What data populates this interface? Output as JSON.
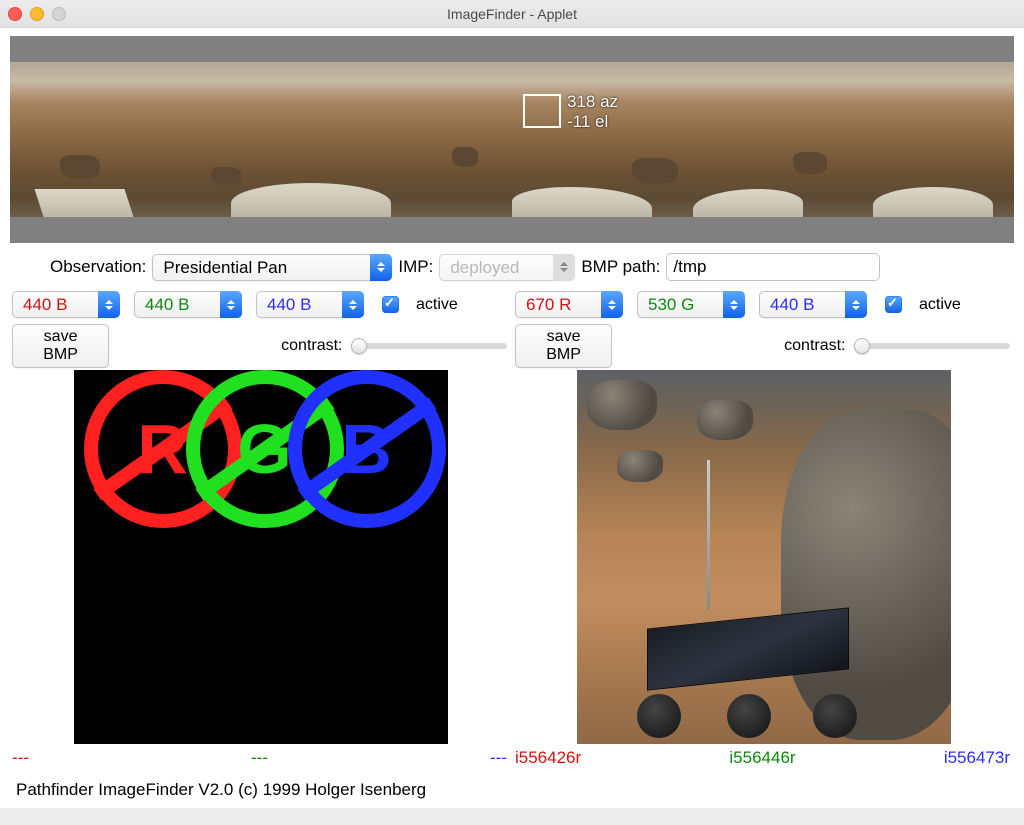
{
  "window": {
    "title": "ImageFinder - Applet"
  },
  "panorama": {
    "selection": {
      "azimuth": "318 az",
      "elevation": "-11 el"
    }
  },
  "controls": {
    "observation_label": "Observation:",
    "observation_value": "Presidential Pan",
    "imp_label": "IMP:",
    "imp_value": "deployed",
    "bmp_label": "BMP path:",
    "bmp_value": "/tmp"
  },
  "left_panel": {
    "filters": {
      "r": "440 B",
      "g": "440 B",
      "b": "440 B"
    },
    "active_label": "active",
    "active": true,
    "save_label": "save BMP",
    "contrast_label": "contrast:",
    "image_labels": {
      "r": "---",
      "g": "---",
      "b": "---"
    }
  },
  "right_panel": {
    "filters": {
      "r": "670 R",
      "g": "530 G",
      "b": "440 B"
    },
    "active_label": "active",
    "active": true,
    "save_label": "save BMP",
    "contrast_label": "contrast:",
    "image_labels": {
      "r": "i556426r",
      "g": "i556446r",
      "b": "i556473r"
    }
  },
  "footer": "Pathfinder ImageFinder V2.0   (c) 1999 Holger Isenberg"
}
